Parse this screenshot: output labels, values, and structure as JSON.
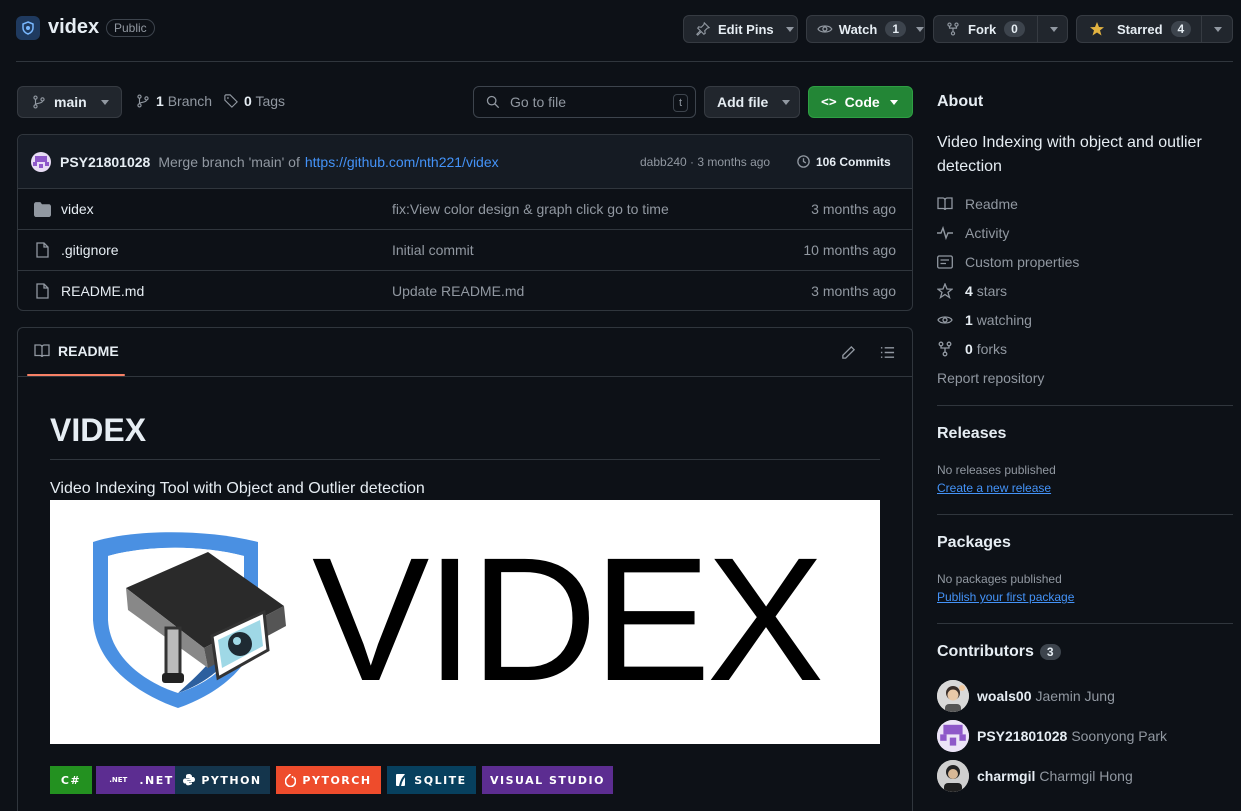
{
  "repo": {
    "name": "videx",
    "visibility": "Public"
  },
  "actions": {
    "edit_pins": "Edit Pins",
    "watch": {
      "label": "Watch",
      "count": "1"
    },
    "fork": {
      "label": "Fork",
      "count": "0"
    },
    "starred": {
      "label": "Starred",
      "count": "4"
    }
  },
  "toolbar": {
    "branch": "main",
    "branches": {
      "count": "1",
      "label": "Branch"
    },
    "tags": {
      "count": "0",
      "label": "Tags"
    },
    "search_placeholder": "Go to file",
    "search_shortcut": "t",
    "add_file": "Add file",
    "code": "Code"
  },
  "commit": {
    "author": "PSY21801028",
    "message": "Merge branch 'main' of",
    "link": "https://github.com/nth221/videx",
    "hash_time": "dabb240 · 3 months ago",
    "commits": "106 Commits"
  },
  "files": [
    {
      "name": "videx",
      "type": "folder",
      "message": "fix:View color design & graph click go to time",
      "time": "3 months ago"
    },
    {
      "name": ".gitignore",
      "type": "file",
      "message": "Initial commit",
      "time": "10 months ago"
    },
    {
      "name": "README.md",
      "type": "file",
      "message": "Update README.md",
      "time": "3 months ago"
    }
  ],
  "readme": {
    "tab": "README",
    "title": "VIDEX",
    "description": "Video Indexing Tool with Object and Outlier detection",
    "logo_text": "VIDEX",
    "badges": [
      {
        "label": "C#",
        "color": "#239120"
      },
      {
        "label": ".NET",
        "sub": ".NET",
        "color": "#5c2d91"
      },
      {
        "label": "PYTHON",
        "color": "#14354c"
      },
      {
        "label": "PYTORCH",
        "color": "#ee4c2c"
      },
      {
        "label": "SQLITE",
        "color": "#07405e"
      },
      {
        "label": "VISUAL STUDIO",
        "color": "#5c2d91"
      }
    ]
  },
  "about": {
    "heading": "About",
    "description": "Video Indexing with object and outlier detection",
    "readme": "Readme",
    "activity": "Activity",
    "custom_properties": "Custom properties",
    "stars": {
      "count": "4",
      "label": "stars"
    },
    "watching": {
      "count": "1",
      "label": "watching"
    },
    "forks": {
      "count": "0",
      "label": "forks"
    },
    "report": "Report repository"
  },
  "releases": {
    "heading": "Releases",
    "empty": "No releases published",
    "link": "Create a new release"
  },
  "packages": {
    "heading": "Packages",
    "empty": "No packages published",
    "link": "Publish your first package"
  },
  "contributors": {
    "heading": "Contributors",
    "count": "3",
    "people": [
      {
        "login": "woals00",
        "name": "Jaemin Jung"
      },
      {
        "login": "PSY21801028",
        "name": "Soonyong Park"
      },
      {
        "login": "charmgil",
        "name": "Charmgil Hong"
      }
    ]
  }
}
